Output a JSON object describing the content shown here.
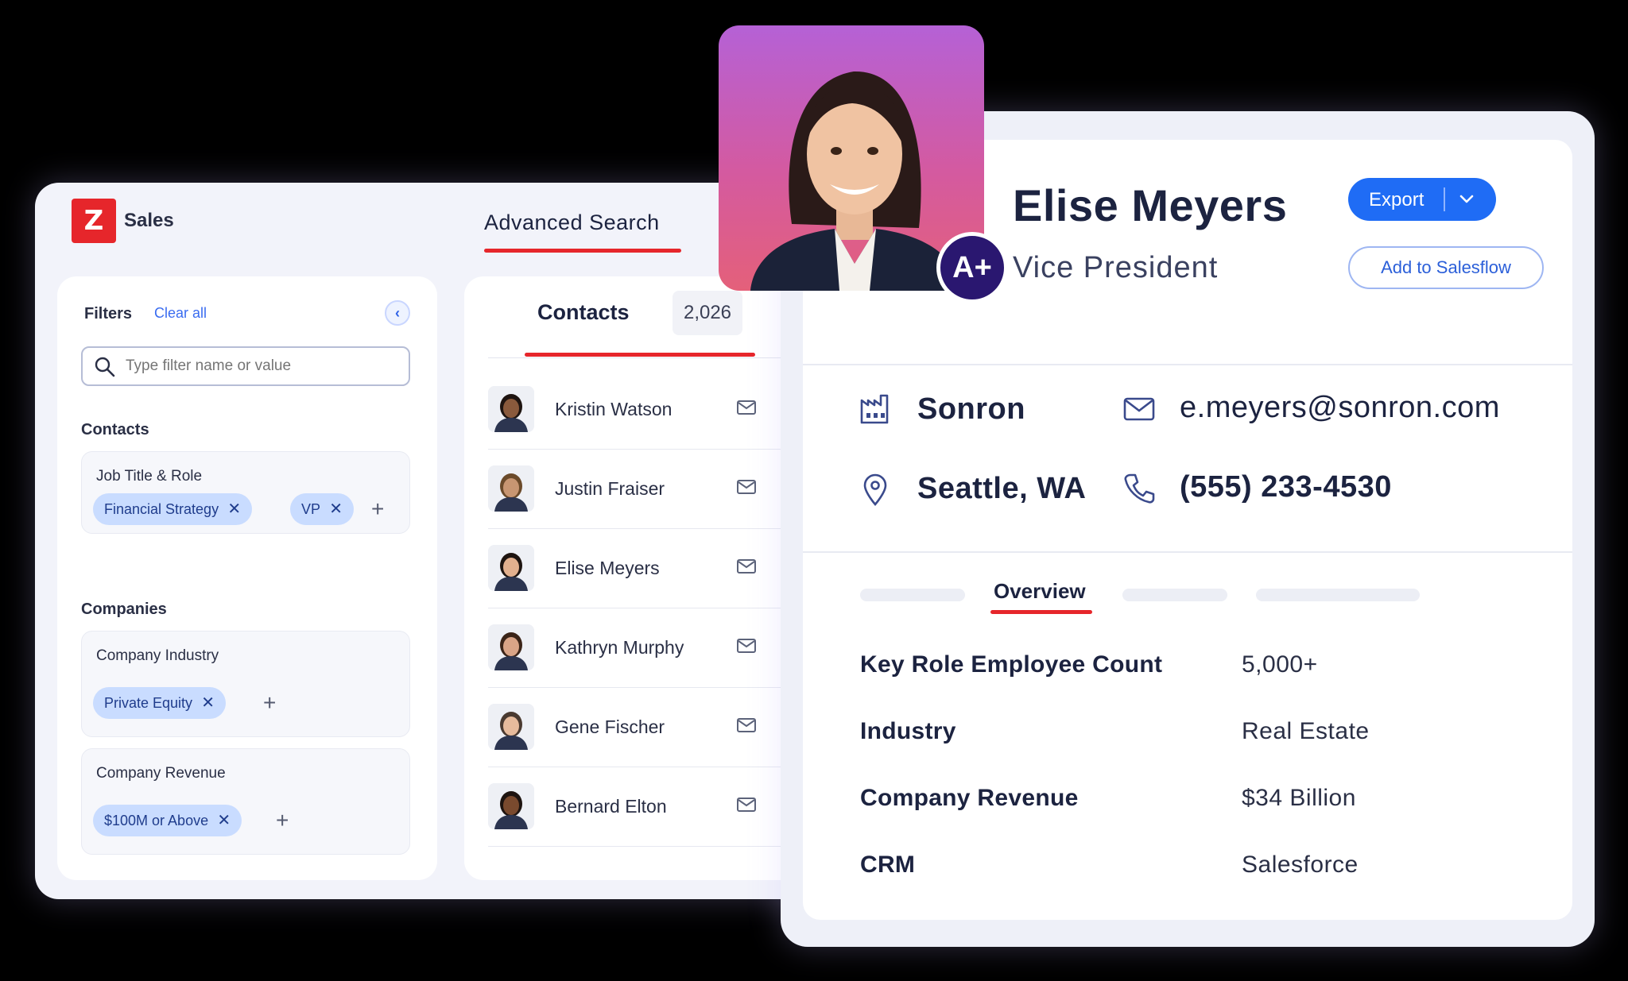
{
  "app": {
    "name": "Sales",
    "logo_letter": "Z",
    "tab": "Advanced Search"
  },
  "filters": {
    "title": "Filters",
    "clear_label": "Clear all",
    "search_placeholder": "Type filter name or value",
    "contacts_section": "Contacts",
    "job_title_card": {
      "title": "Job Title & Role",
      "chips": [
        "Financial Strategy",
        "VP"
      ]
    },
    "companies_section": "Companies",
    "industry_card": {
      "title": "Company Industry",
      "chips": [
        "Private Equity"
      ]
    },
    "revenue_card": {
      "title": "Company Revenue",
      "chips": [
        "$100M or Above"
      ]
    },
    "chip_remove": "✕",
    "add": "+"
  },
  "contacts": {
    "title": "Contacts",
    "count": "2,026",
    "rows": [
      {
        "name": "Kristin Watson"
      },
      {
        "name": "Justin Fraiser"
      },
      {
        "name": "Elise Meyers"
      },
      {
        "name": "Kathryn Murphy"
      },
      {
        "name": "Gene Fischer"
      },
      {
        "name": "Bernard Elton"
      }
    ]
  },
  "profile": {
    "name": "Elise Meyers",
    "title": "Vice President",
    "grade": "A+",
    "export_label": "Export",
    "salesflow_label": "Add to Salesflow",
    "company": "Sonron",
    "email": "e.meyers@sonron.com",
    "location": "Seattle, WA",
    "phone": "(555) 233-4530",
    "tab_active": "Overview",
    "details": [
      {
        "key": "Key Role Employee Count",
        "value": "5,000+"
      },
      {
        "key": "Industry",
        "value": "Real Estate"
      },
      {
        "key": "Company Revenue",
        "value": "$34 Billion"
      },
      {
        "key": "CRM",
        "value": "Salesforce"
      }
    ]
  },
  "colors": {
    "brand_red": "#e6262b",
    "primary_blue": "#1f6cf5",
    "badge_purple": "#2a1770"
  }
}
